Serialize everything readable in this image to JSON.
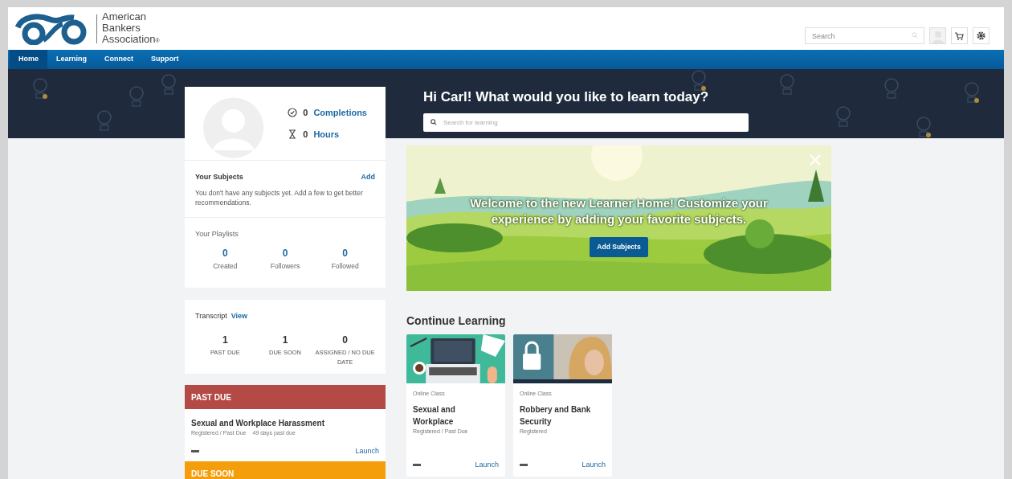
{
  "header": {
    "logo_lines": [
      "American",
      "Bankers",
      "Association"
    ],
    "logo_mark": "®",
    "search": {
      "placeholder": "Search"
    }
  },
  "nav": [
    {
      "label": "Home",
      "selected": true
    },
    {
      "label": "Learning",
      "selected": false
    },
    {
      "label": "Connect",
      "selected": false
    },
    {
      "label": "Support",
      "selected": false
    }
  ],
  "hero": {
    "greeting": "Hi Carl! What would you like to learn today?",
    "search": {
      "placeholder": "Search for learning"
    }
  },
  "profile": {
    "stats": [
      {
        "kind": "completions",
        "value": "0",
        "label": "Completions"
      },
      {
        "kind": "hours",
        "value": "0",
        "label": "Hours"
      }
    ],
    "subjects": {
      "title": "Your Subjects",
      "action": "Add",
      "message": "You don't have any subjects yet. Add a few to get better recommendations."
    },
    "playlists": {
      "title": "Your Playlists",
      "counts": [
        {
          "value": "0",
          "label": "Created"
        },
        {
          "value": "0",
          "label": "Followers"
        },
        {
          "value": "0",
          "label": "Followed"
        }
      ]
    }
  },
  "transcript": {
    "title": "Transcript",
    "action": "View",
    "counts": [
      {
        "value": "1",
        "label": "PAST DUE"
      },
      {
        "value": "1",
        "label": "DUE SOON"
      },
      {
        "value": "0",
        "label": "ASSIGNED / NO DUE DATE"
      }
    ]
  },
  "sections": [
    {
      "title": "PAST DUE",
      "color": "#b44a45",
      "items": [
        {
          "title": "Sexual and Workplace Harassment",
          "status": "Registered / Past Due",
          "due": "49 days past due",
          "action": "Launch"
        }
      ]
    },
    {
      "title": "DUE SOON",
      "color": "#f59e0b"
    }
  ],
  "welcome": {
    "message": "Welcome to the new Learner Home! Customize your experience by adding your favorite subjects.",
    "button": "Add Subjects"
  },
  "continue": {
    "title": "Continue Learning",
    "cards": [
      {
        "kind": "laptop",
        "type": "Online Class",
        "title": "Sexual and Workplace",
        "status": "Registered / Past Due",
        "action": "Launch"
      },
      {
        "kind": "lock",
        "type": "Online Class",
        "title": "Robbery and Bank Security",
        "status": "Registered",
        "action": "Launch"
      }
    ]
  }
}
